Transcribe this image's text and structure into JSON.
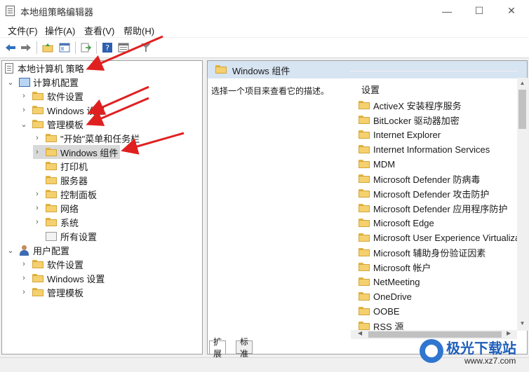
{
  "window": {
    "title": "本地组策略编辑器",
    "controls": {
      "minimize": "—",
      "maximize": "☐",
      "close": "✕"
    }
  },
  "menubar": [
    {
      "label": "文件(F)"
    },
    {
      "label": "操作(A)"
    },
    {
      "label": "查看(V)"
    },
    {
      "label": "帮助(H)"
    }
  ],
  "toolbar": {
    "icons": [
      "back-arrow-icon",
      "forward-arrow-icon",
      "folder-up-icon",
      "show-hide-tree-icon",
      "export-list-icon",
      "help-icon",
      "properties-icon",
      "filter-icon"
    ]
  },
  "tree": {
    "root": "本地计算机 策略",
    "computer_config": "计算机配置",
    "cc_software": "软件设置",
    "cc_windows": "Windows 设置",
    "cc_admin": "管理模板",
    "start_menu": "\"开始\"菜单和任务栏",
    "windows_components": "Windows 组件",
    "printers": "打印机",
    "server": "服务器",
    "control_panel": "控制面板",
    "network": "网络",
    "system": "系统",
    "all_settings": "所有设置",
    "user_config": "用户配置",
    "uc_software": "软件设置",
    "uc_windows": "Windows 设置",
    "uc_admin": "管理模板"
  },
  "right_pane": {
    "header": "Windows 组件",
    "description": "选择一个项目来查看它的描述。",
    "column_header": "设置",
    "items": [
      "ActiveX 安装程序服务",
      "BitLocker 驱动器加密",
      "Internet Explorer",
      "Internet Information Services",
      "MDM",
      "Microsoft Defender 防病毒",
      "Microsoft Defender 攻击防护",
      "Microsoft Defender 应用程序防护",
      "Microsoft Edge",
      "Microsoft User Experience Virtualization",
      "Microsoft 辅助身份验证因素",
      "Microsoft 帐户",
      "NetMeeting",
      "OneDrive",
      "OOBE",
      "RSS 源"
    ]
  },
  "tabs": {
    "extended": "扩展",
    "standard": "标准"
  },
  "watermark": {
    "text": "极光下载站",
    "url": "www.xz7.com"
  },
  "colors": {
    "annotation_arrow": "#e02020",
    "header_bg": "#d7e4f2",
    "folder": "#f5d06e"
  }
}
